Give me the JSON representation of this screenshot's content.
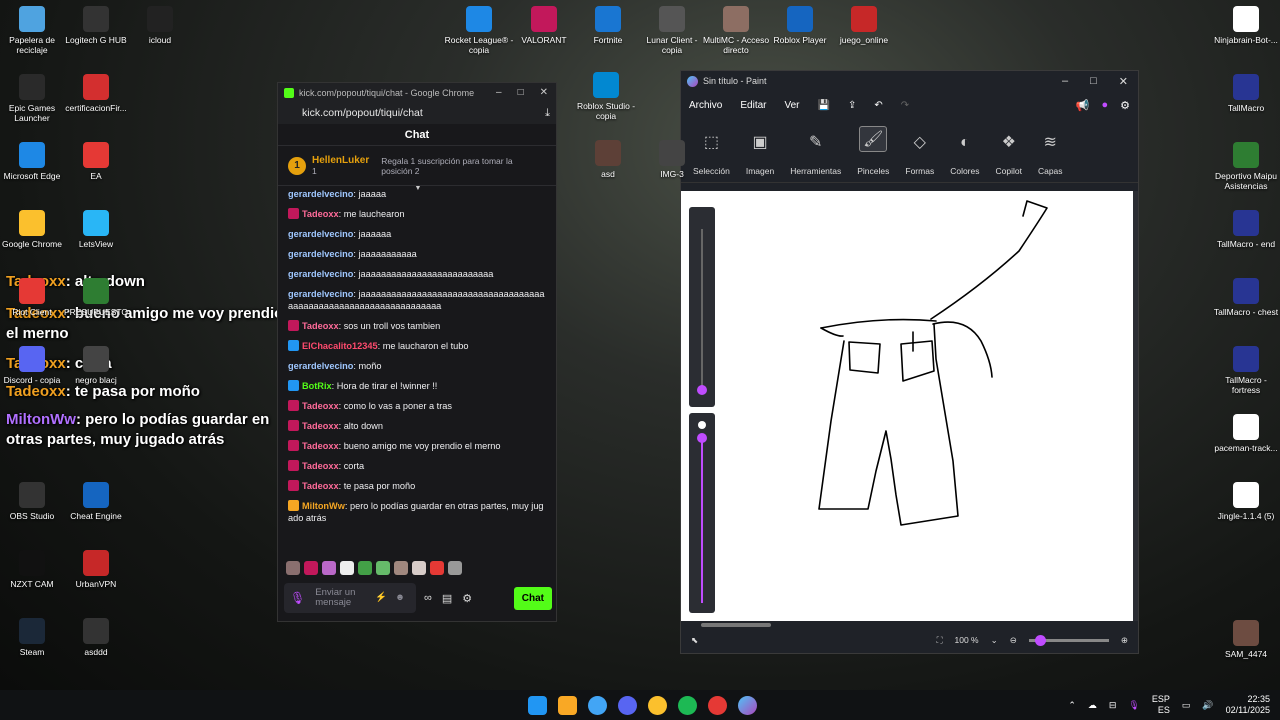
{
  "desktop_left": [
    {
      "label": "Papelera de reciclaje",
      "icon": "recycle-bin-icon",
      "color": "#4fa3e0"
    },
    {
      "label": "Logitech G HUB",
      "icon": "logitech-icon",
      "color": "#333"
    },
    {
      "label": "icloud",
      "icon": "icloud-icon",
      "color": "#222"
    },
    {
      "label": "Epic Games Launcher",
      "icon": "epic-icon",
      "color": "#2a2a2a"
    },
    {
      "label": "certificacionFir...",
      "icon": "pdf-icon",
      "color": "#d32f2f"
    },
    {
      "label": "Microsoft Edge",
      "icon": "edge-icon",
      "color": "#1e88e5"
    },
    {
      "label": "EA",
      "icon": "ea-icon",
      "color": "#e53935"
    },
    {
      "label": "Google Chrome",
      "icon": "chrome-icon",
      "color": "#fbc02d"
    },
    {
      "label": "LetsView",
      "icon": "letsview-icon",
      "color": "#29b6f6"
    },
    {
      "label": "Riot Client",
      "icon": "riot-icon",
      "color": "#e53935"
    },
    {
      "label": "PRESUPUESTO",
      "icon": "excel-icon",
      "color": "#2e7d32"
    },
    {
      "label": "Discord - copia",
      "icon": "discord-icon",
      "color": "#5865f2"
    },
    {
      "label": "negro blacj",
      "icon": "image-icon",
      "color": "#444"
    },
    {
      "label": "OBS Studio",
      "icon": "obs-icon",
      "color": "#333"
    },
    {
      "label": "Cheat Engine",
      "icon": "cheat-engine-icon",
      "color": "#1565c0"
    },
    {
      "label": "NZXT CAM",
      "icon": "nzxt-icon",
      "color": "#111"
    },
    {
      "label": "UrbanVPN",
      "icon": "vpn-icon",
      "color": "#c62828"
    },
    {
      "label": "Steam",
      "icon": "steam-icon",
      "color": "#1b2838"
    },
    {
      "label": "asddd",
      "icon": "file-icon",
      "color": "#333"
    }
  ],
  "desktop_top": [
    {
      "label": "Rocket League® - copia",
      "icon": "rocket-league-icon",
      "color": "#1e88e5"
    },
    {
      "label": "VALORANT",
      "icon": "valorant-icon",
      "color": "#c2185b"
    },
    {
      "label": "Fortnite",
      "icon": "fortnite-icon",
      "color": "#1976d2"
    },
    {
      "label": "Lunar Client - copia",
      "icon": "lunar-icon",
      "color": "#555"
    },
    {
      "label": "MultiMC - Acceso directo",
      "icon": "multimc-icon",
      "color": "#8d6e63"
    },
    {
      "label": "Roblox Player",
      "icon": "roblox-icon",
      "color": "#1565c0"
    },
    {
      "label": "juego_online",
      "icon": "game-icon",
      "color": "#c62828"
    }
  ],
  "desktop_mid": [
    {
      "label": "Roblox Studio - copia",
      "icon": "roblox-studio-icon",
      "color": "#0288d1"
    },
    {
      "label": "asd",
      "icon": "image-icon",
      "color": "#5d4037"
    },
    {
      "label": "IMG-3",
      "icon": "image-icon",
      "color": "#444"
    }
  ],
  "desktop_right": [
    {
      "label": "Ninjabrain-Bot-...",
      "icon": "java-icon",
      "color": "#fff"
    },
    {
      "label": "TallMacro",
      "icon": "tallmacro-icon",
      "color": "#283593"
    },
    {
      "label": "Deportivo Maipu Asistencias",
      "icon": "excel-icon",
      "color": "#2e7d32"
    },
    {
      "label": "TallMacro - end",
      "icon": "tallmacro-icon",
      "color": "#283593"
    },
    {
      "label": "TallMacro - chest",
      "icon": "tallmacro-icon",
      "color": "#283593"
    },
    {
      "label": "TallMacro - fortress",
      "icon": "tallmacro-icon",
      "color": "#283593"
    },
    {
      "label": "paceman-track...",
      "icon": "java-icon",
      "color": "#fff"
    },
    {
      "label": "Jingle-1.1.4 (5)",
      "icon": "java-icon",
      "color": "#fff"
    },
    {
      "label": "SAM_4474",
      "icon": "image-icon",
      "color": "#6d4c41"
    }
  ],
  "overlay": [
    {
      "user": "Tadeoxx",
      "text": ": alto down"
    },
    {
      "user": "Tadeoxx",
      "text": ": bueno amigo me voy prendio el merno"
    },
    {
      "user": "Tadeoxx",
      "text": ": corta"
    },
    {
      "user": "Tadeoxx",
      "text": ": te pasa por moño"
    },
    {
      "user": "MiltonWw",
      "text": ": pero lo podías guardar en otras partes, muy jugado atrás"
    }
  ],
  "chrome": {
    "title": "kick.com/popout/tiqui/chat - Google Chrome",
    "url": "kick.com/popout/tiqui/chat",
    "chat_header": "Chat",
    "pinned_rank": "1",
    "pinned_user": "HellenLuker",
    "pinned_count": "1",
    "pinned_text": "Regala 1 suscripción para tomar la posición 2",
    "messages": [
      {
        "user": "gerardelvecino",
        "text": ": jaaaaa",
        "cls": "u-g",
        "badge": ""
      },
      {
        "user": "Tadeoxx",
        "text": ": me lauchearon",
        "cls": "u-t",
        "badge": "mod"
      },
      {
        "user": "gerardelvecino",
        "text": ": jaaaaaa",
        "cls": "u-g",
        "badge": ""
      },
      {
        "user": "gerardelvecino",
        "text": ": jaaaaaaaaaaa",
        "cls": "u-g",
        "badge": ""
      },
      {
        "user": "gerardelvecino",
        "text": ": jaaaaaaaaaaaaaaaaaaaaaaaaaa",
        "cls": "u-g",
        "badge": ""
      },
      {
        "user": "gerardelvecino",
        "text": ": jaaaaaaaaaaaaaaaaaaaaaaaaaaaaaaaaaaaaaaaaaaaaaaaaaaaaaaaaaaaaaaaaaa",
        "cls": "u-g",
        "badge": ""
      },
      {
        "user": "Tadeoxx",
        "text": ": sos un troll vos tambien",
        "cls": "u-t",
        "badge": "mod"
      },
      {
        "user": "ElChacalito12345",
        "text": ": me laucharon el tubo",
        "cls": "u-c",
        "badge": "blue"
      },
      {
        "user": "gerardelvecino",
        "text": ": moño",
        "cls": "u-g",
        "badge": ""
      },
      {
        "user": "BotRix",
        "text": ": Hora de tirar el !winner !!",
        "cls": "u-b",
        "badge": "blue"
      },
      {
        "user": "Tadeoxx",
        "text": ": como lo vas a poner a tras",
        "cls": "u-t",
        "badge": "mod"
      },
      {
        "user": "Tadeoxx",
        "text": ": alto down",
        "cls": "u-t",
        "badge": "mod"
      },
      {
        "user": "Tadeoxx",
        "text": ": bueno amigo me voy prendio el merno",
        "cls": "u-t",
        "badge": "mod"
      },
      {
        "user": "Tadeoxx",
        "text": ": corta",
        "cls": "u-t",
        "badge": "mod"
      },
      {
        "user": "Tadeoxx",
        "text": ": te pasa por moño",
        "cls": "u-t",
        "badge": "mod"
      },
      {
        "user": "MiltonWw",
        "text": ": pero lo podías guardar en otras partes, muy jugado atrás",
        "cls": "u-m",
        "badge": "org"
      }
    ],
    "input_placeholder": "Enviar un mensaje",
    "send_label": "Chat"
  },
  "paint": {
    "title": "Sin título - Paint",
    "menu": [
      "Archivo",
      "Editar",
      "Ver"
    ],
    "ribbon": [
      {
        "label": "Selección",
        "icon": "selection-icon",
        "glyph": "⬚"
      },
      {
        "label": "Imagen",
        "icon": "image-tool-icon",
        "glyph": "▣"
      },
      {
        "label": "Herramientas",
        "icon": "tools-icon",
        "glyph": "✎"
      },
      {
        "label": "Pinceles",
        "icon": "brush-icon",
        "glyph": "🖌"
      },
      {
        "label": "Formas",
        "icon": "shapes-icon",
        "glyph": "◇"
      },
      {
        "label": "Colores",
        "icon": "colors-icon",
        "glyph": "◐"
      },
      {
        "label": "Copilot",
        "icon": "copilot-icon",
        "glyph": "❖"
      },
      {
        "label": "Capas",
        "icon": "layers-icon",
        "glyph": "≋"
      }
    ],
    "zoom": "100 %"
  },
  "taskbar": {
    "lang": "ESP",
    "region": "ES",
    "time": "22:35",
    "date": "02/11/2025"
  }
}
